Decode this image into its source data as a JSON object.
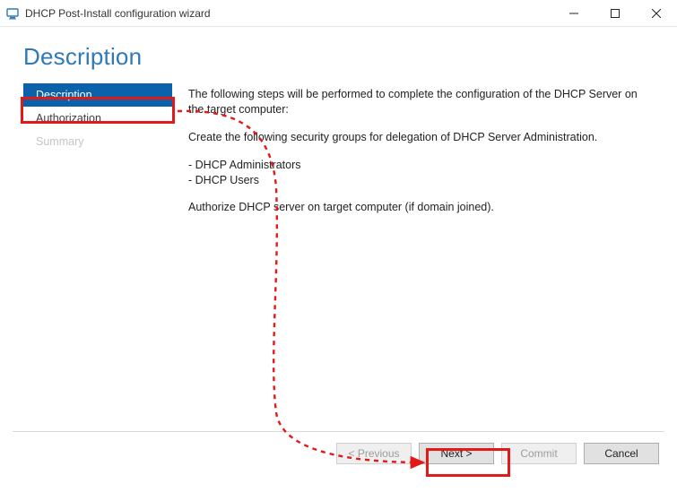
{
  "window": {
    "title": "DHCP Post-Install configuration wizard"
  },
  "page": {
    "heading": "Description"
  },
  "nav": {
    "items": [
      {
        "label": "Description",
        "state": "selected"
      },
      {
        "label": "Authorization",
        "state": "normal"
      },
      {
        "label": "Summary",
        "state": "disabled"
      }
    ]
  },
  "content": {
    "intro": "The following steps will be performed to complete the configuration of the DHCP Server on the target computer:",
    "groups_intro": "Create the following security groups for delegation of DHCP Server Administration.",
    "group1": "- DHCP Administrators",
    "group2": "- DHCP Users",
    "authorize": "Authorize DHCP server on target computer (if domain joined)."
  },
  "buttons": {
    "previous": "< Previous",
    "next": "Next >",
    "commit": "Commit",
    "cancel": "Cancel"
  },
  "annotation": {
    "color": "#e11a19"
  }
}
